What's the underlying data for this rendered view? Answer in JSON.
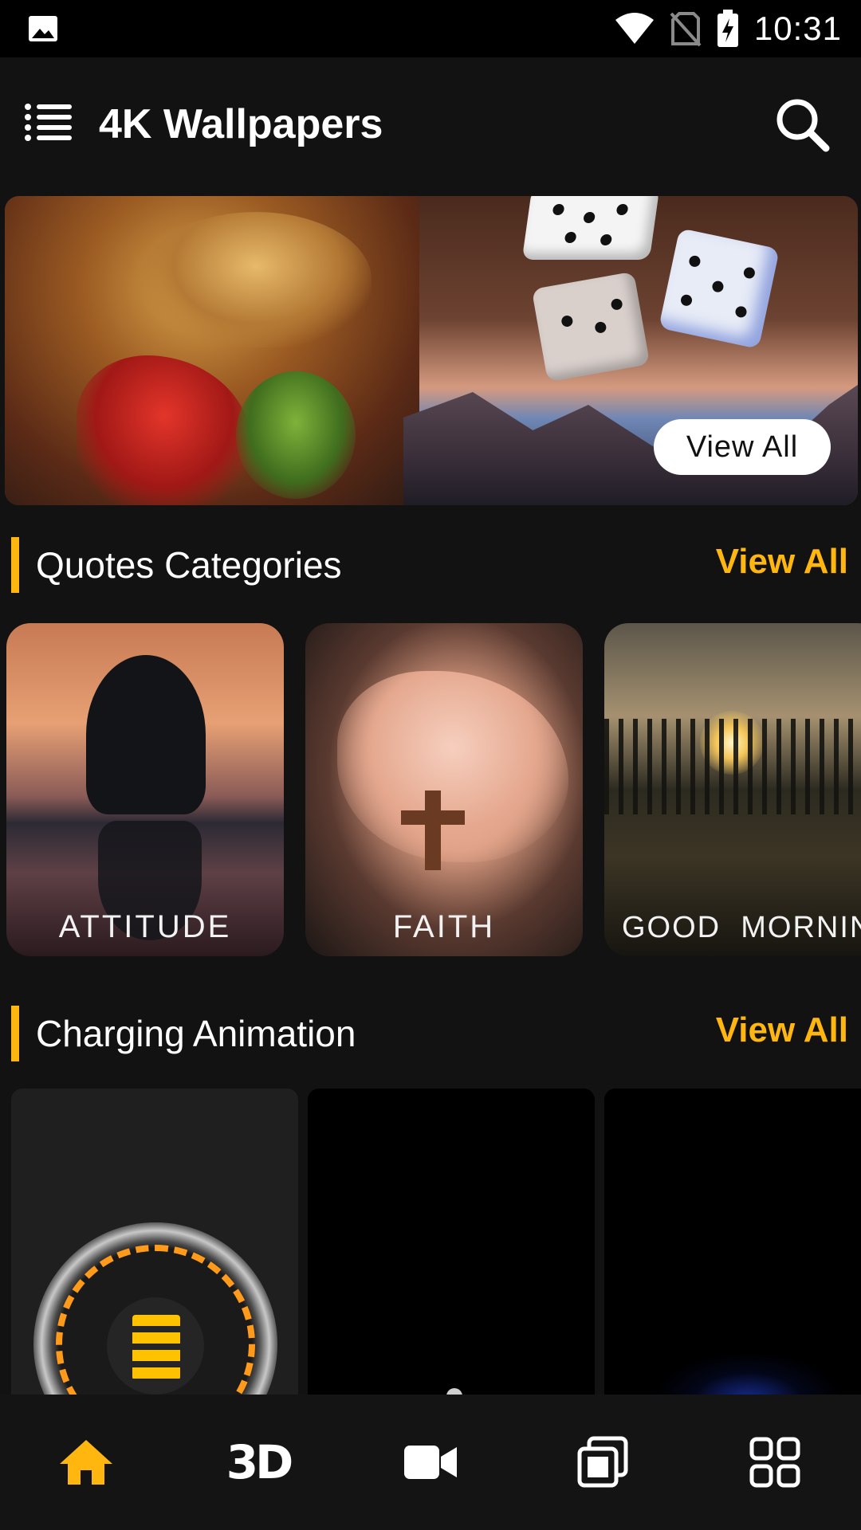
{
  "status_bar": {
    "time": "10:31",
    "icons": [
      "image-icon",
      "wifi-icon",
      "no-sim-icon",
      "battery-charging-icon"
    ]
  },
  "app_bar": {
    "title": "4K Wallpapers",
    "menu_icon": "menu-icon",
    "search_icon": "search-icon"
  },
  "banner": {
    "view_all_label": "View All"
  },
  "quotes_section": {
    "title": "Quotes Categories",
    "view_all_label": "View All",
    "cards": [
      {
        "label": "ATTITUDE"
      },
      {
        "label": "FAITH"
      },
      {
        "label": "GOOD  MORNING"
      }
    ]
  },
  "charging_section": {
    "title": "Charging Animation",
    "view_all_label": "View All"
  },
  "bottom_nav": {
    "items": [
      {
        "name": "home",
        "icon": "home-icon",
        "label": "",
        "active": true
      },
      {
        "name": "3d",
        "icon": "3d-icon",
        "label": "3D",
        "active": false
      },
      {
        "name": "video",
        "icon": "video-camera-icon",
        "label": "",
        "active": false
      },
      {
        "name": "gallery",
        "icon": "gallery-icon",
        "label": "",
        "active": false
      },
      {
        "name": "categories",
        "icon": "grid-icon",
        "label": "",
        "active": false
      }
    ]
  },
  "colors": {
    "accent": "#ffb60f",
    "background": "#121212",
    "status_bar": "#000000"
  }
}
